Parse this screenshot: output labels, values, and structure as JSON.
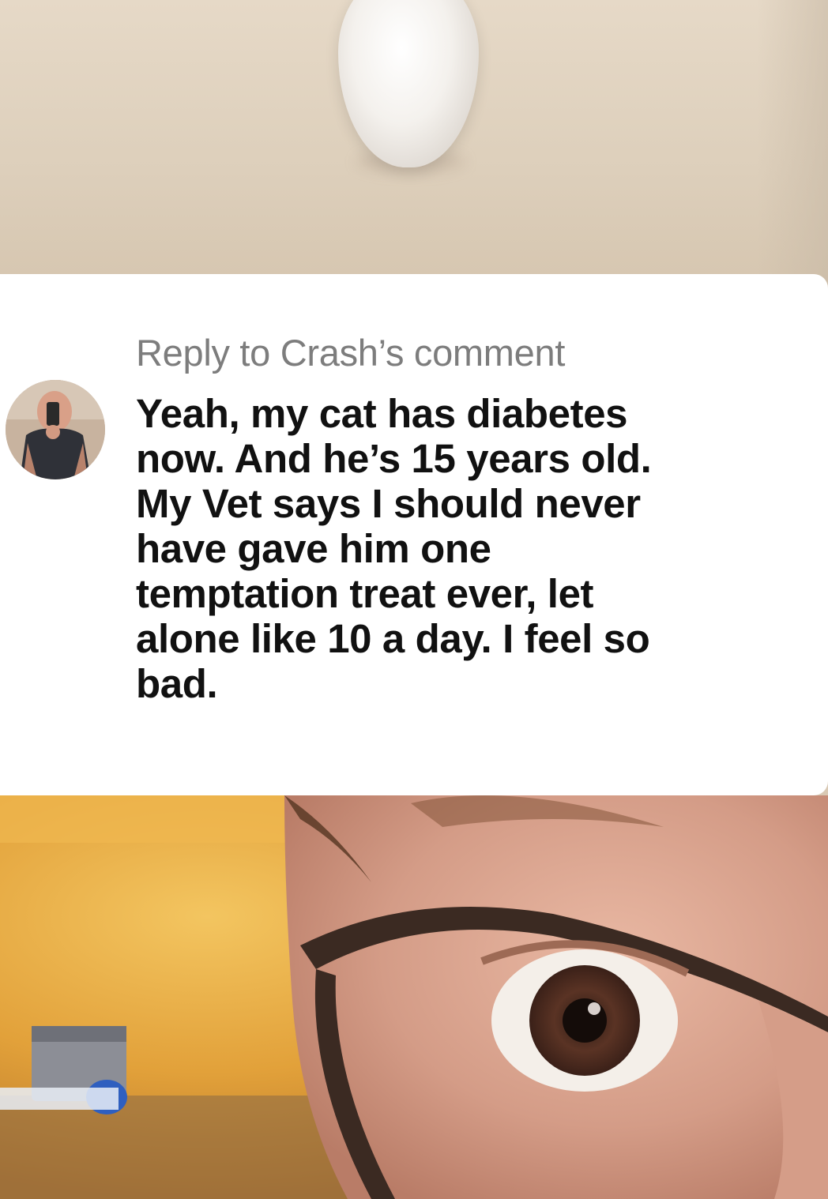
{
  "comment": {
    "reply_label": "Reply to Crash’s comment",
    "text": "Yeah, my cat has diabetes\nnow. And he’s 15 years old.\nMy Vet says I should never\nhave gave him one\ntemptation treat ever, let\nalone like 10 a day. I feel so\nbad."
  },
  "colors": {
    "card_background": "#ffffff",
    "reply_label": "#7d7d7d",
    "comment_text": "#111111"
  }
}
